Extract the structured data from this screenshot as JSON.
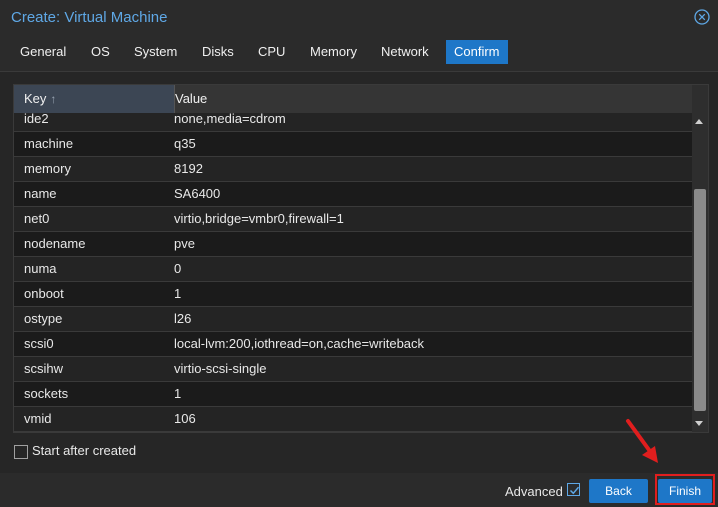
{
  "window": {
    "title": "Create: Virtual Machine"
  },
  "tabs": [
    {
      "label": "General"
    },
    {
      "label": "OS"
    },
    {
      "label": "System"
    },
    {
      "label": "Disks"
    },
    {
      "label": "CPU"
    },
    {
      "label": "Memory"
    },
    {
      "label": "Network"
    },
    {
      "label": "Confirm",
      "active": true
    }
  ],
  "grid": {
    "columns": {
      "key": "Key",
      "value": "Value"
    },
    "sort_indicator": "↑",
    "rows": [
      {
        "key": "ide2",
        "value": "none,media=cdrom"
      },
      {
        "key": "machine",
        "value": "q35"
      },
      {
        "key": "memory",
        "value": "8192"
      },
      {
        "key": "name",
        "value": "SA6400"
      },
      {
        "key": "net0",
        "value": "virtio,bridge=vmbr0,firewall=1"
      },
      {
        "key": "nodename",
        "value": "pve"
      },
      {
        "key": "numa",
        "value": "0"
      },
      {
        "key": "onboot",
        "value": "1"
      },
      {
        "key": "ostype",
        "value": "l26"
      },
      {
        "key": "scsi0",
        "value": "local-lvm:200,iothread=on,cache=writeback"
      },
      {
        "key": "scsihw",
        "value": "virtio-scsi-single"
      },
      {
        "key": "sockets",
        "value": "1"
      },
      {
        "key": "vmid",
        "value": "106"
      }
    ]
  },
  "options": {
    "start_after_created": "Start after created",
    "start_after_created_checked": false
  },
  "footer": {
    "advanced_label": "Advanced",
    "advanced_checked": true,
    "back_label": "Back",
    "finish_label": "Finish"
  },
  "colors": {
    "accent": "#1e77c8",
    "title": "#5fa8e6",
    "highlight": "#e01e1e"
  }
}
